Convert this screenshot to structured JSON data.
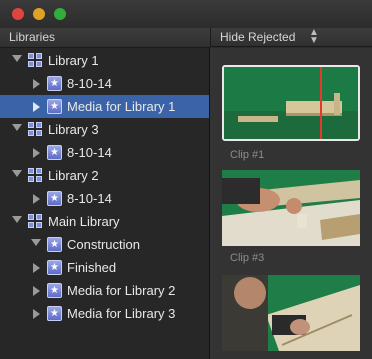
{
  "window": {
    "controls": [
      "close",
      "minimize",
      "zoom"
    ]
  },
  "libraries_header": {
    "title": "Libraries"
  },
  "browser_header": {
    "filter_label": "Hide Rejected",
    "stepper_glyph": "⬍"
  },
  "sidebar": {
    "rows": [
      {
        "label": "Library 1",
        "kind": "library",
        "expanded": true,
        "indent": 0
      },
      {
        "label": "8-10-14",
        "kind": "event",
        "expanded": false,
        "indent": 1
      },
      {
        "label": "Media for Library 1",
        "kind": "event",
        "expanded": false,
        "indent": 1,
        "selected": true
      },
      {
        "label": "Library 3",
        "kind": "library",
        "expanded": true,
        "indent": 0
      },
      {
        "label": "8-10-14",
        "kind": "event",
        "expanded": false,
        "indent": 1
      },
      {
        "label": "Library 2",
        "kind": "library",
        "expanded": true,
        "indent": 0
      },
      {
        "label": "8-10-14",
        "kind": "event",
        "expanded": false,
        "indent": 1
      },
      {
        "label": "Main Library",
        "kind": "library",
        "expanded": true,
        "indent": 0
      },
      {
        "label": "Construction",
        "kind": "event",
        "expanded": true,
        "indent": 1
      },
      {
        "label": "Finished",
        "kind": "event",
        "expanded": false,
        "indent": 1
      },
      {
        "label": "Media for Library 2",
        "kind": "event",
        "expanded": false,
        "indent": 1
      },
      {
        "label": "Media for Library 3",
        "kind": "event",
        "expanded": false,
        "indent": 1
      }
    ]
  },
  "browser": {
    "clips": [
      {
        "label": "Clip #1",
        "selected": true,
        "thumbnail": "green-screen-table"
      },
      {
        "label": "Clip #3",
        "selected": false,
        "thumbnail": "hands-on-board"
      },
      {
        "label": "",
        "selected": false,
        "thumbnail": "man-with-sander"
      }
    ]
  },
  "colors": {
    "selection": "#3b63a8",
    "playhead": "#e33b2b",
    "event_icon": "#7c8fd8"
  }
}
